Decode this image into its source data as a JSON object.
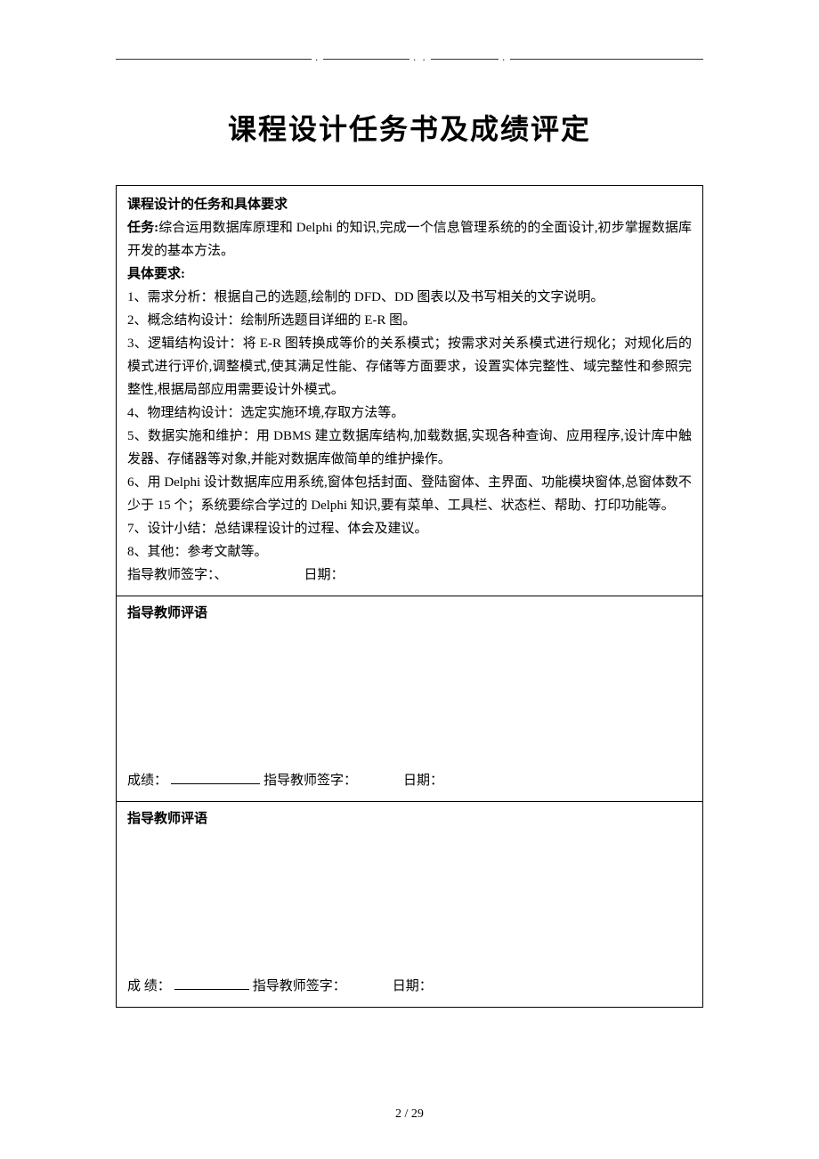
{
  "title": "课程设计任务书及成绩评定",
  "section1": {
    "heading": "课程设计的任务和具体要求",
    "task_label": "任务:",
    "task_text": "综合运用数据库原理和 Delphi 的知识,完成一个信息管理系统的的全面设计,初步掌握数据库开发的基本方法。",
    "req_label": "具体要求:",
    "items": [
      "1、需求分析：根据自己的选题,绘制的 DFD、DD 图表以及书写相关的文字说明。",
      "2、概念结构设计：绘制所选题目详细的 E-R 图。",
      "3、逻辑结构设计：将 E-R 图转换成等价的关系模式；按需求对关系模式进行规化；对规化后的模式进行评价,调整模式,使其满足性能、存储等方面要求，设置实体完整性、域完整性和参照完整性,根据局部应用需要设计外模式。",
      "4、物理结构设计：选定实施环境,存取方法等。",
      "5、数据实施和维护：用 DBMS 建立数据库结构,加载数据,实现各种查询、应用程序,设计库中触发器、存储器等对象,并能对数据库做简单的维护操作。",
      "6、用 Delphi 设计数据库应用系统,窗体包括封面、登陆窗体、主界面、功能模块窗体,总窗体数不少于 15 个；系统要综合学过的 Delphi 知识,要有菜单、工具栏、状态栏、帮助、打印功能等。",
      "7、设计小结：总结课程设计的过程、体会及建议。",
      "8、其他：参考文献等。"
    ],
    "sign_teacher": "指导教师签字：",
    "sign_sep": "、",
    "sign_date": "日期："
  },
  "section2": {
    "heading": "指导教师评语",
    "grade_label": "成绩：",
    "sign_teacher": "指导教师签字：",
    "sign_date": "日期："
  },
  "section3": {
    "heading": "指导教师评语",
    "grade_label": "成 绩：",
    "sign_teacher": "指导教师签字：",
    "sign_date": "日期："
  },
  "footer": "2  / 29"
}
